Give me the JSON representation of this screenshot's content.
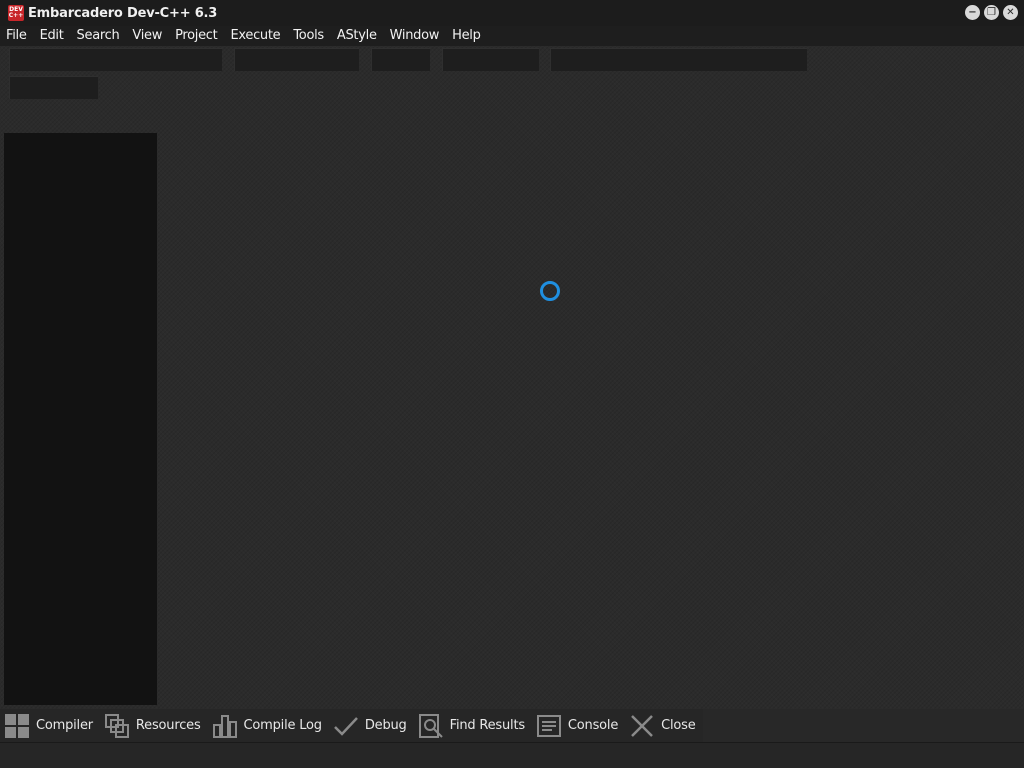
{
  "window": {
    "title": "Embarcadero Dev-C++ 6.3",
    "icon_text_line1": "DEV",
    "icon_text_line2": "C++",
    "minimize_glyph": "−",
    "restore_glyph": "❐",
    "close_glyph": "✕"
  },
  "menu": {
    "items": [
      {
        "label": "File"
      },
      {
        "label": "Edit"
      },
      {
        "label": "Search"
      },
      {
        "label": "View"
      },
      {
        "label": "Project"
      },
      {
        "label": "Execute"
      },
      {
        "label": "Tools"
      },
      {
        "label": "AStyle"
      },
      {
        "label": "Window"
      },
      {
        "label": "Help"
      }
    ]
  },
  "bottom_tabs": [
    {
      "label": "Compiler",
      "icon": "grid-icon"
    },
    {
      "label": "Resources",
      "icon": "resources-icon"
    },
    {
      "label": "Compile Log",
      "icon": "chart-icon"
    },
    {
      "label": "Debug",
      "icon": "check-icon"
    },
    {
      "label": "Find Results",
      "icon": "find-icon"
    },
    {
      "label": "Console",
      "icon": "console-icon"
    },
    {
      "label": "Close",
      "icon": "close-icon"
    }
  ],
  "colors": {
    "spinner": "#1f8fe0",
    "background": "#2b2b2b",
    "panel": "#121212"
  }
}
